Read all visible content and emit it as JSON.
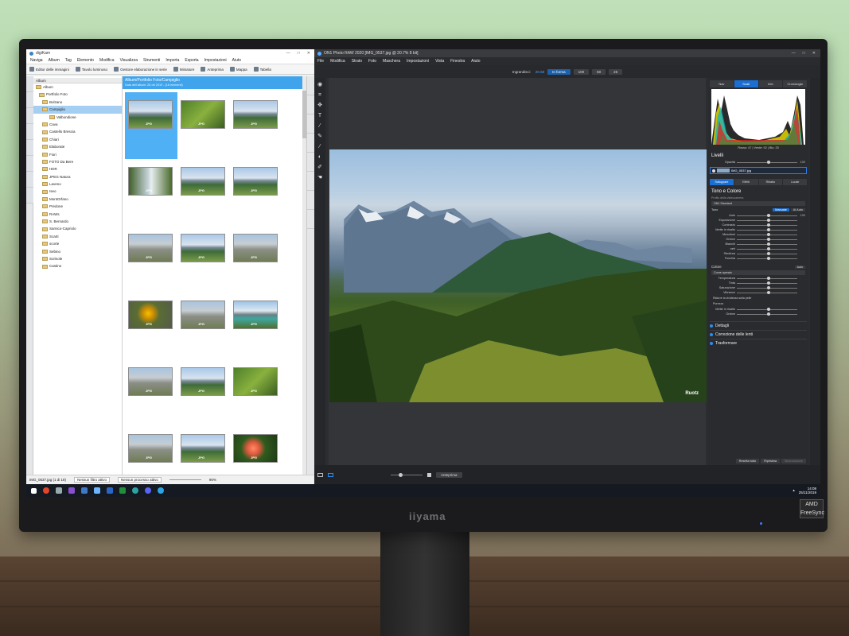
{
  "digikam": {
    "title": "digiKam",
    "menu": [
      "Naviga",
      "Album",
      "Tag",
      "Elemento",
      "Modifica",
      "Visualizza",
      "Strumenti",
      "Importa",
      "Esporta",
      "Impostazioni",
      "Aiuto"
    ],
    "toolbar": [
      "Editor delle immagini",
      "Tavolo luminoso",
      "Gestore elaborazione in serie",
      "Miniature",
      "Anteprima",
      "Mappa",
      "Tabella"
    ],
    "tree_header": "Album",
    "tree": [
      "Album",
      "Portfolio Foto",
      "Bolzano",
      "Campiglio",
      "Valbondione",
      "Cava",
      "Castello Brescia",
      "Chiari",
      "Elaborate",
      "Fiori",
      "FOTO Da Bere",
      "HDR",
      "JPEG Natura",
      "Laveno",
      "Iseo",
      "MontOrfano",
      "Predone",
      "RAWs",
      "S. Bernardo",
      "Sarnico-Capriolo",
      "Scarti",
      "scorte",
      "Sebino",
      "Sorisole",
      "Castino"
    ],
    "selected_node": "Campiglio",
    "album_header": "Album/Portfolio Foto/Campiglio",
    "album_sub": "Data dell'album: 28 ott 2019 - (18 elementi)",
    "thumb_badge": "JPG",
    "status_file": "IMG_0537.jpg (1 di 18)",
    "status_filter": "Nessun filtro attivo",
    "status_process": "Nessun processo attivo",
    "zoom": "96%"
  },
  "on1": {
    "title": "ON1 Photo RAW 2020 [IMG_0537.jpg @ 20.7% 8 bit]",
    "menu": [
      "File",
      "Modifica",
      "Strato",
      "Foto",
      "Maschera",
      "Impostazioni",
      "Vista",
      "Finestra",
      "Aiuto"
    ],
    "zoom_label": "Ingrandisci:",
    "zoom_value": "20.68",
    "zoom_buttons": [
      "In forma",
      "100",
      "50",
      "25"
    ],
    "watermark": "Ruotz",
    "preview_label": "Anteprima",
    "panel_tabs": [
      "Nav",
      "Scali",
      "Info",
      "Cronologia"
    ],
    "rgb_readout": "Rosso: 47  |  Verde: 92  |  Blu: 25",
    "layers_title": "Livelli",
    "opacity_label": "Opacità",
    "opacity_value": "100",
    "layer_name": "IMG_0537.jpg",
    "develop_tabs": [
      "Sviluppare",
      "Effetti",
      "Ritratto",
      "Locale"
    ],
    "tone_title": "Tono e Colore",
    "profile_label": "Profilo della videocamera",
    "profile_value": "ON1 Standard",
    "tone_label": "Tono",
    "tone_manual": "Manuale",
    "tone_auto": "AI Auto",
    "auto_readout": "Auto",
    "tone_auto_value": "100",
    "sliders": [
      "Esposizione",
      "Contrasto",
      "Mette in risalto",
      "Mezzitoni",
      "Ombre",
      "Bianchi",
      "neri",
      "Struttura",
      "Foschia"
    ],
    "color_title": "Colore",
    "color_auto": "Auto",
    "color_dropdown": "Come operato",
    "color_sliders": [
      "Temperatura",
      "Tinta",
      "Saturazione",
      "Vibrance"
    ],
    "skin_checkbox": "Ridurre la vividezza sulla pelle",
    "purezza": "Purezza",
    "purezza_sliders": [
      "Mette in risalto",
      "Ombre"
    ],
    "accordions": [
      "Dettagli",
      "Correzione delle lenti",
      "Trasformare"
    ],
    "footer_buttons": [
      "Resetta tutto",
      "Ripristina",
      "Sincronizzare"
    ]
  },
  "taskbar": {
    "time": "14:08",
    "date": "25/11/2019"
  },
  "monitor": {
    "brand": "iiyama",
    "badge": "AMD FreeSync"
  }
}
